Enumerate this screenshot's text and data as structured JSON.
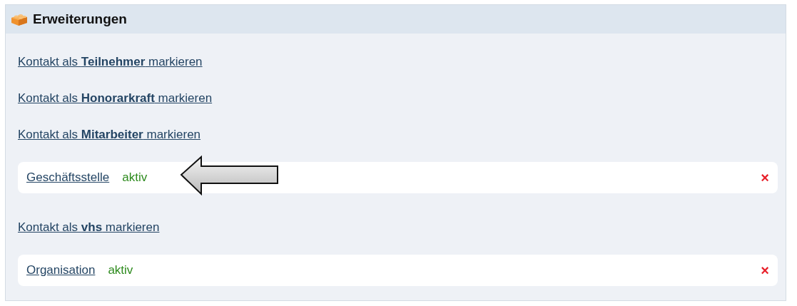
{
  "panel": {
    "title": "Erweiterungen"
  },
  "items": [
    {
      "kind": "link",
      "text": "Kontakt als **Teilnehmer** markieren"
    },
    {
      "kind": "link",
      "text": "Kontakt als **Honorarkraft** markieren"
    },
    {
      "kind": "link",
      "text": "Kontakt als **Mitarbeiter** markieren"
    },
    {
      "kind": "active",
      "label": "Geschäftsstelle",
      "status": "aktiv",
      "remove": "×",
      "arrow": true
    },
    {
      "kind": "link",
      "text": "Kontakt als **vhs** markieren"
    },
    {
      "kind": "active",
      "label": "Organisation",
      "status": "aktiv",
      "remove": "×",
      "arrow": false
    }
  ]
}
